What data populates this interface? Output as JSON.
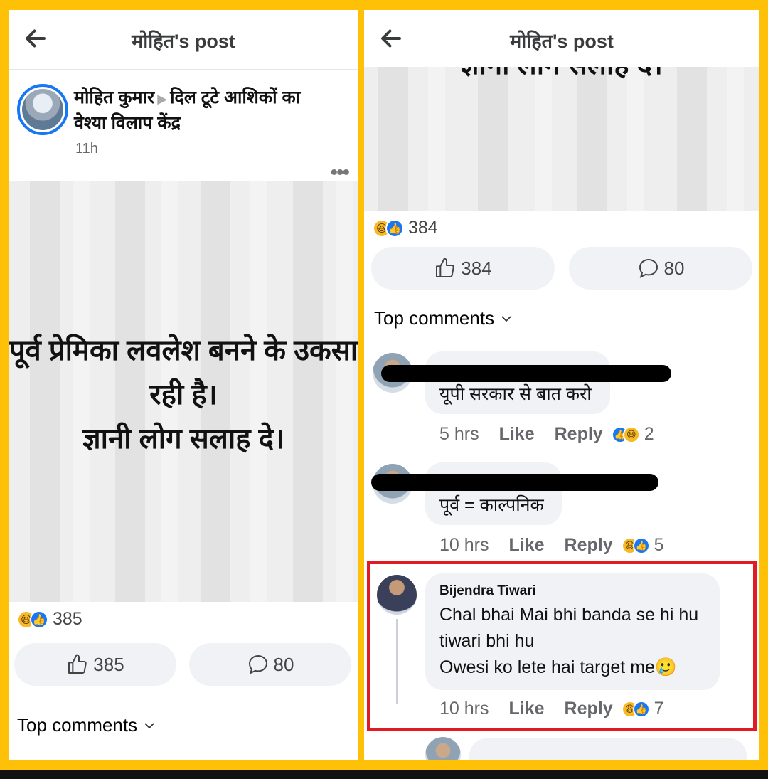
{
  "left": {
    "topbar": {
      "title": "मोहित's post"
    },
    "post": {
      "author": "मोहित कुमार",
      "separator": "▶",
      "group": "दिल टूटे आशिकों का वेश्या विलाप केंद्र",
      "time": "11h",
      "more": "•••",
      "text_line1": "पूर्व प्रेमिका लवलेश बनने के उकसा",
      "text_line2": "रही है।",
      "text_line3": "ज्ञानी लोग सलाह दे।"
    },
    "reaction_count": "385",
    "like_count": "385",
    "comment_count": "80",
    "top_comments": "Top comments"
  },
  "right": {
    "topbar": {
      "title": "मोहित's post"
    },
    "post_text_partial": "ज्ञानी लोग सलाह दे।",
    "reaction_count": "384",
    "like_count": "384",
    "comment_count": "80",
    "top_comments": "Top comments",
    "comments": [
      {
        "name": "",
        "text": "यूपी सरकार से बात करो",
        "time": "5 hrs",
        "like": "Like",
        "reply": "Reply",
        "reactions": "2"
      },
      {
        "name": "",
        "text": "पूर्व = काल्पनिक",
        "time": "10 hrs",
        "like": "Like",
        "reply": "Reply",
        "reactions": "5"
      },
      {
        "name": "Bijendra Tiwari",
        "text_line1": "Chal bhai Mai bhi banda se hi hu",
        "text_line2": "tiwari bhi hu",
        "text_line3": "Owesi ko lete hai target me🥲",
        "time": "10 hrs",
        "like": "Like",
        "reply": "Reply",
        "reactions": "7"
      }
    ]
  },
  "colors": {
    "frame": "#ffc107",
    "facebook_blue": "#1877f2",
    "highlight_red": "#e01b24",
    "pill_bg": "#f0f2f5"
  }
}
